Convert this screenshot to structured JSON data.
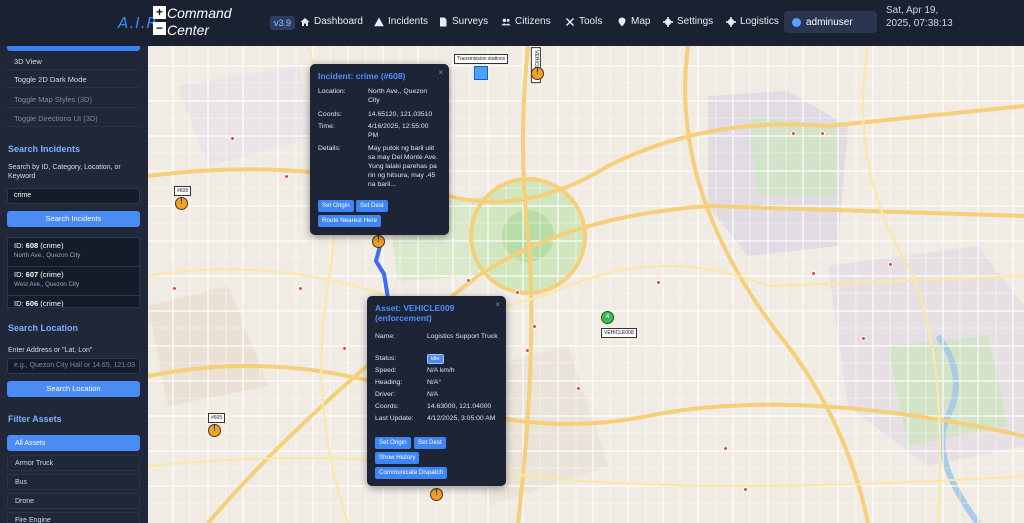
{
  "header": {
    "brand": "A.I.R.",
    "brand_suffix": "Command Center",
    "brand_icon_top": "+",
    "brand_icon_bottom": "−",
    "version": "v3.9",
    "nav": [
      {
        "label": "Dashboard",
        "icon": "home-icon"
      },
      {
        "label": "Incidents",
        "icon": "warning-icon"
      },
      {
        "label": "Surveys",
        "icon": "document-icon"
      },
      {
        "label": "Citizens",
        "icon": "users-icon"
      },
      {
        "label": "Tools",
        "icon": "tools-icon"
      },
      {
        "label": "Map",
        "icon": "map-pin-icon"
      },
      {
        "label": "Settings",
        "icon": "gear-icon"
      },
      {
        "label": "Logistics",
        "icon": "gear-icon"
      }
    ],
    "user": "adminuser",
    "datetime": "Sat, Apr 19, 2025, 07:38:13"
  },
  "sidebar": {
    "map_options": [
      {
        "label": "3D View"
      },
      {
        "label": "Toggle 2D Dark Mode"
      },
      {
        "label": "Toggle Map Styles (3D)"
      },
      {
        "label": "Toggle Directions UI (3D)"
      }
    ],
    "search_incidents": {
      "title": "Search Incidents",
      "label": "Search by ID, Category, Location, or Keyword",
      "value": "crime",
      "button": "Search Incidents",
      "results": [
        {
          "id_label": "ID: ",
          "id": "608",
          "cat": " (crime)",
          "location": "North Ave., Quezon City"
        },
        {
          "id_label": "ID: ",
          "id": "607",
          "cat": " (crime)",
          "location": "West Ave., Quezon City"
        },
        {
          "id_label": "ID: ",
          "id": "606",
          "cat": " (crime)",
          "location": ""
        }
      ]
    },
    "search_location": {
      "title": "Search Location",
      "label": "Enter Address or \"Lat, Lon\"",
      "placeholder": "e.g., Quezon City Hall or 14.65, 121.03",
      "button": "Search Location"
    },
    "filter_assets": {
      "title": "Filter Assets",
      "items": [
        "All Assets",
        "Armor Truck",
        "Bus",
        "Drone",
        "Fire Engine"
      ]
    }
  },
  "map": {
    "labels": {
      "transmission": "Transmission stations",
      "incident_608": "#608",
      "incident_605": "#605",
      "vehicle_tag_1": "VEHICLE005",
      "vehicle_tag_2": "VEHICLE008",
      "green_count": "4"
    },
    "incident_popup": {
      "title": "Incident: crime (#608)",
      "close": "×",
      "rows": [
        {
          "label": "Location:",
          "value": "North Ave., Quezon City"
        },
        {
          "label": "Coords:",
          "value": "14.65120, 121.03510"
        },
        {
          "label": "Time:",
          "value": "4/16/2025, 12:55:00 PM"
        },
        {
          "label": "Details:",
          "value": "May putok ng baril ulit sa may Del Monte Ave. Yung lalaki parehas pa rin ng hitsura, may .45 na baril..."
        }
      ],
      "buttons": [
        "Set Origin",
        "Set Dest",
        "Route Nearest Here"
      ]
    },
    "asset_popup": {
      "title": "Asset: VEHICLE009 (enforcement)",
      "close": "×",
      "rows": [
        {
          "label": "Name:",
          "value": "Logistics Support Truck"
        },
        {
          "label": "Status:",
          "value": "idle"
        },
        {
          "label": "Speed:",
          "value": "N/A km/h"
        },
        {
          "label": "Heading:",
          "value": "N/A°"
        },
        {
          "label": "Driver:",
          "value": "N/A"
        },
        {
          "label": "Coords:",
          "value": "14.63000, 121.04000"
        },
        {
          "label": "Last Update:",
          "value": "4/12/2025, 3:05:00 AM"
        }
      ],
      "buttons": [
        "Set Origin",
        "Set Dest",
        "Show History",
        "Communicate Dispatch"
      ]
    }
  },
  "colors": {
    "accent": "#4a8cf4",
    "sidebar_bg": "#1f2738",
    "header_bg": "#1a2232",
    "incident_marker": "#f0a22a",
    "route": "#3a6ff0"
  }
}
